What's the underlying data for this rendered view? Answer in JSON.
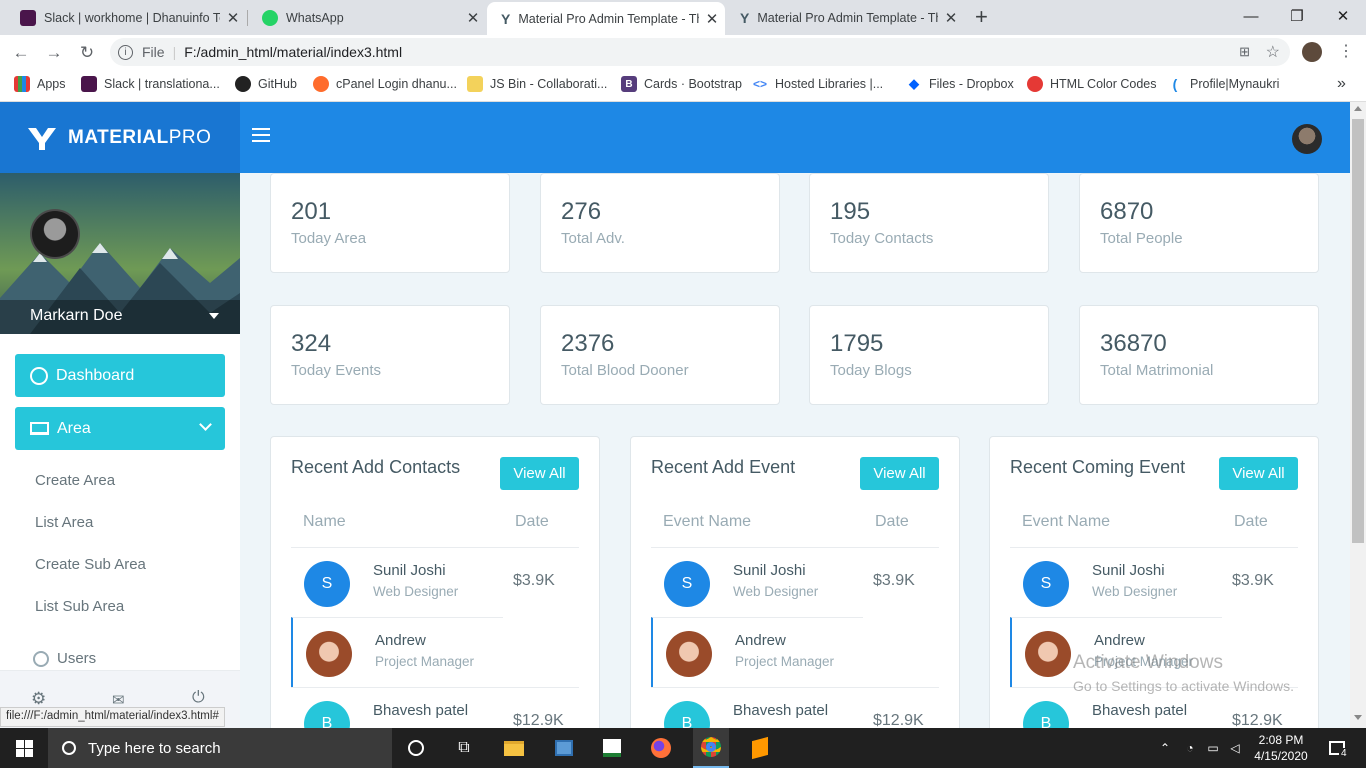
{
  "browser": {
    "tabs": [
      {
        "title": "Slack | workhome | Dhanuinfo Te",
        "icon": "slack-icon"
      },
      {
        "title": "WhatsApp",
        "icon": "whatsapp-icon"
      },
      {
        "title": "Material Pro Admin Template - Th",
        "icon": "materialpro-icon"
      },
      {
        "title": "Material Pro Admin Template - Th",
        "icon": "materialpro-icon"
      }
    ],
    "new_tab": "+",
    "url_prefix": "File",
    "url": "F:/admin_html/material/index3.html",
    "bookmarks": [
      {
        "label": "Apps",
        "icon": "apps-grid-icon"
      },
      {
        "label": "Slack | translationa...",
        "icon": "slack-icon"
      },
      {
        "label": "GitHub",
        "icon": "github-icon"
      },
      {
        "label": "cPanel Login dhanu...",
        "icon": "cpanel-icon"
      },
      {
        "label": "JS Bin - Collaborati...",
        "icon": "jsbin-icon"
      },
      {
        "label": "Cards · Bootstrap",
        "icon": "bootstrap-icon"
      },
      {
        "label": "Hosted Libraries  |...",
        "icon": "code-icon"
      },
      {
        "label": "Files - Dropbox",
        "icon": "dropbox-icon"
      },
      {
        "label": "HTML Color Codes",
        "icon": "color-codes-icon"
      },
      {
        "label": "Profile|Mynaukri",
        "icon": "naukri-icon"
      }
    ],
    "more_bookmarks": "»",
    "status_url": "file:///F:/admin_html/material/index3.html#"
  },
  "app": {
    "brand_main": "MATERIAL",
    "brand_sub": "PRO",
    "user_name": "Markarn Doe",
    "nav": {
      "dashboard": "Dashboard",
      "area": "Area",
      "sub_items": [
        "Create Area",
        "List Area",
        "Create Sub Area",
        "List Sub Area"
      ],
      "users": "Users"
    },
    "stats": [
      {
        "value": "201",
        "label": "Today Area"
      },
      {
        "value": "276",
        "label": "Total Adv."
      },
      {
        "value": "195",
        "label": "Today Contacts"
      },
      {
        "value": "6870",
        "label": "Total People"
      },
      {
        "value": "324",
        "label": "Today Events"
      },
      {
        "value": "2376",
        "label": "Total Blood Dooner"
      },
      {
        "value": "1795",
        "label": "Today Blogs"
      },
      {
        "value": "36870",
        "label": "Total Matrimonial"
      }
    ],
    "panels": [
      {
        "title": "Recent Add Contacts",
        "button": "View All",
        "col1": "Name",
        "col2": "Date"
      },
      {
        "title": "Recent Add Event",
        "button": "View All",
        "col1": "Event Name",
        "col2": "Date"
      },
      {
        "title": "Recent Coming Event",
        "button": "View All",
        "col1": "Event Name",
        "col2": "Date"
      }
    ],
    "rows": [
      {
        "initial": "S",
        "name": "Sunil Joshi",
        "role": "Web Designer",
        "value": "$3.9K"
      },
      {
        "initial": "",
        "name": "Andrew",
        "role": "Project Manager",
        "value": ""
      },
      {
        "initial": "B",
        "name": "Bhavesh patel",
        "role": "",
        "value": "$12.9K"
      }
    ],
    "colors": {
      "topbar": "#1e88e5",
      "logo_bg": "#1976d2",
      "accent": "#26c6da"
    }
  },
  "watermark": {
    "line1": "Activate Windows",
    "line2": "Go to Settings to activate Windows."
  },
  "taskbar": {
    "search_placeholder": "Type here to search",
    "time": "2:08 PM",
    "date": "4/15/2020",
    "notification_count": "4"
  }
}
